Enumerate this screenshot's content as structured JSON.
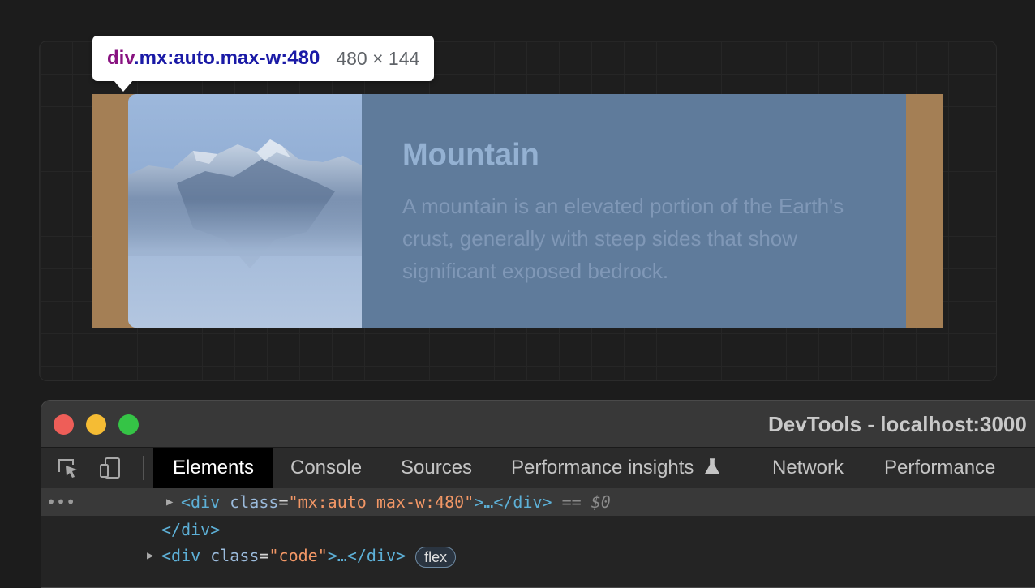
{
  "tooltip": {
    "tag": "div",
    "classes": ".mx:auto.max-w:480",
    "size": "480 × 144"
  },
  "card": {
    "title": "Mountain",
    "description": "A mountain is an elevated portion of the Earth's crust, generally with steep sides that show significant exposed bedrock.",
    "image_icon": "mountain-photo"
  },
  "colors": {
    "margin_overlay": "#a47f55",
    "card_overlay": "#5f7b9b",
    "tooltip_tag": "#881280",
    "tooltip_selector": "#1a1aa6"
  },
  "devtools": {
    "window_title": "DevTools - localhost:3000",
    "tabs": [
      {
        "label": "Elements",
        "active": true
      },
      {
        "label": "Console"
      },
      {
        "label": "Sources"
      },
      {
        "label": "Performance insights"
      },
      {
        "label": "Network"
      },
      {
        "label": "Performance"
      }
    ],
    "dom": {
      "row1": {
        "open": "<div ",
        "attr": "class",
        "eq": "=",
        "value": "\"mx:auto max-w:480\"",
        "rest": ">…</div>",
        "marker": " == ",
        "ref": "$0"
      },
      "row2": {
        "close": "</div>"
      },
      "row3": {
        "open": "<div ",
        "attr": "class",
        "eq": "=",
        "value": "\"code\"",
        "rest": ">…</div>",
        "badge": "flex"
      }
    }
  }
}
